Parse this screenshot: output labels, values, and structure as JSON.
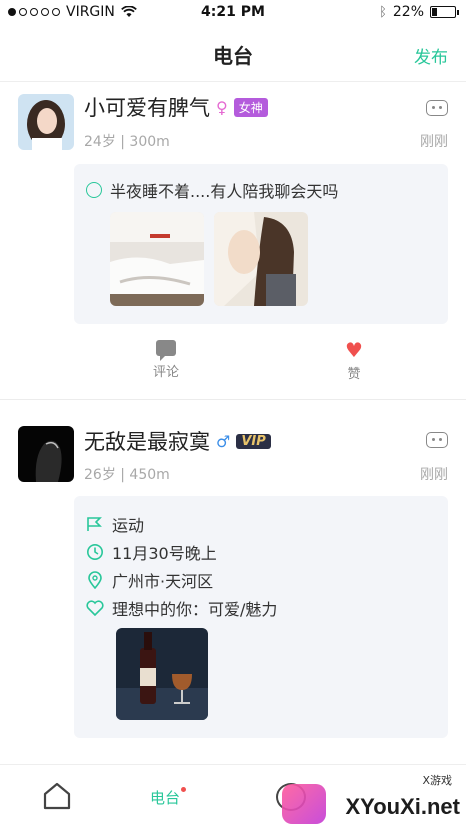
{
  "status_bar": {
    "carrier": "VIRGIN",
    "time": "4:21 PM",
    "battery": "22%",
    "battery_level": 0.22
  },
  "header": {
    "title": "电台",
    "publish_label": "发布"
  },
  "posts": [
    {
      "name": "小可爱有脾气",
      "gender_symbol": "♀",
      "badge": "女神",
      "meta": "24岁 | 300m",
      "time_ago": "刚刚",
      "text": "半夜睡不着....有人陪我聊会天吗",
      "actions": {
        "comment": "评论",
        "like": "赞"
      }
    },
    {
      "name": "无敌是最寂寞",
      "gender_symbol": "♂",
      "badge": "VIP",
      "meta": "26岁 | 450m",
      "time_ago": "刚刚",
      "details": [
        {
          "icon": "flag-icon",
          "text": "运动"
        },
        {
          "icon": "clock-icon",
          "text": "11月30号晚上"
        },
        {
          "icon": "location-pin-icon",
          "text": "广州市·天河区"
        },
        {
          "icon": "heart-outline-icon",
          "text": "理想中的你：可爱/魅力"
        }
      ]
    }
  ],
  "tabbar": {
    "radio_label": "电台"
  },
  "watermark": {
    "text": "XYouXi.net",
    "small": "X游戏"
  },
  "colors": {
    "accent": "#29c79a",
    "like": "#f0504e",
    "goddess_badge": "#b45bdc",
    "card_bg": "#f3f5f9"
  }
}
